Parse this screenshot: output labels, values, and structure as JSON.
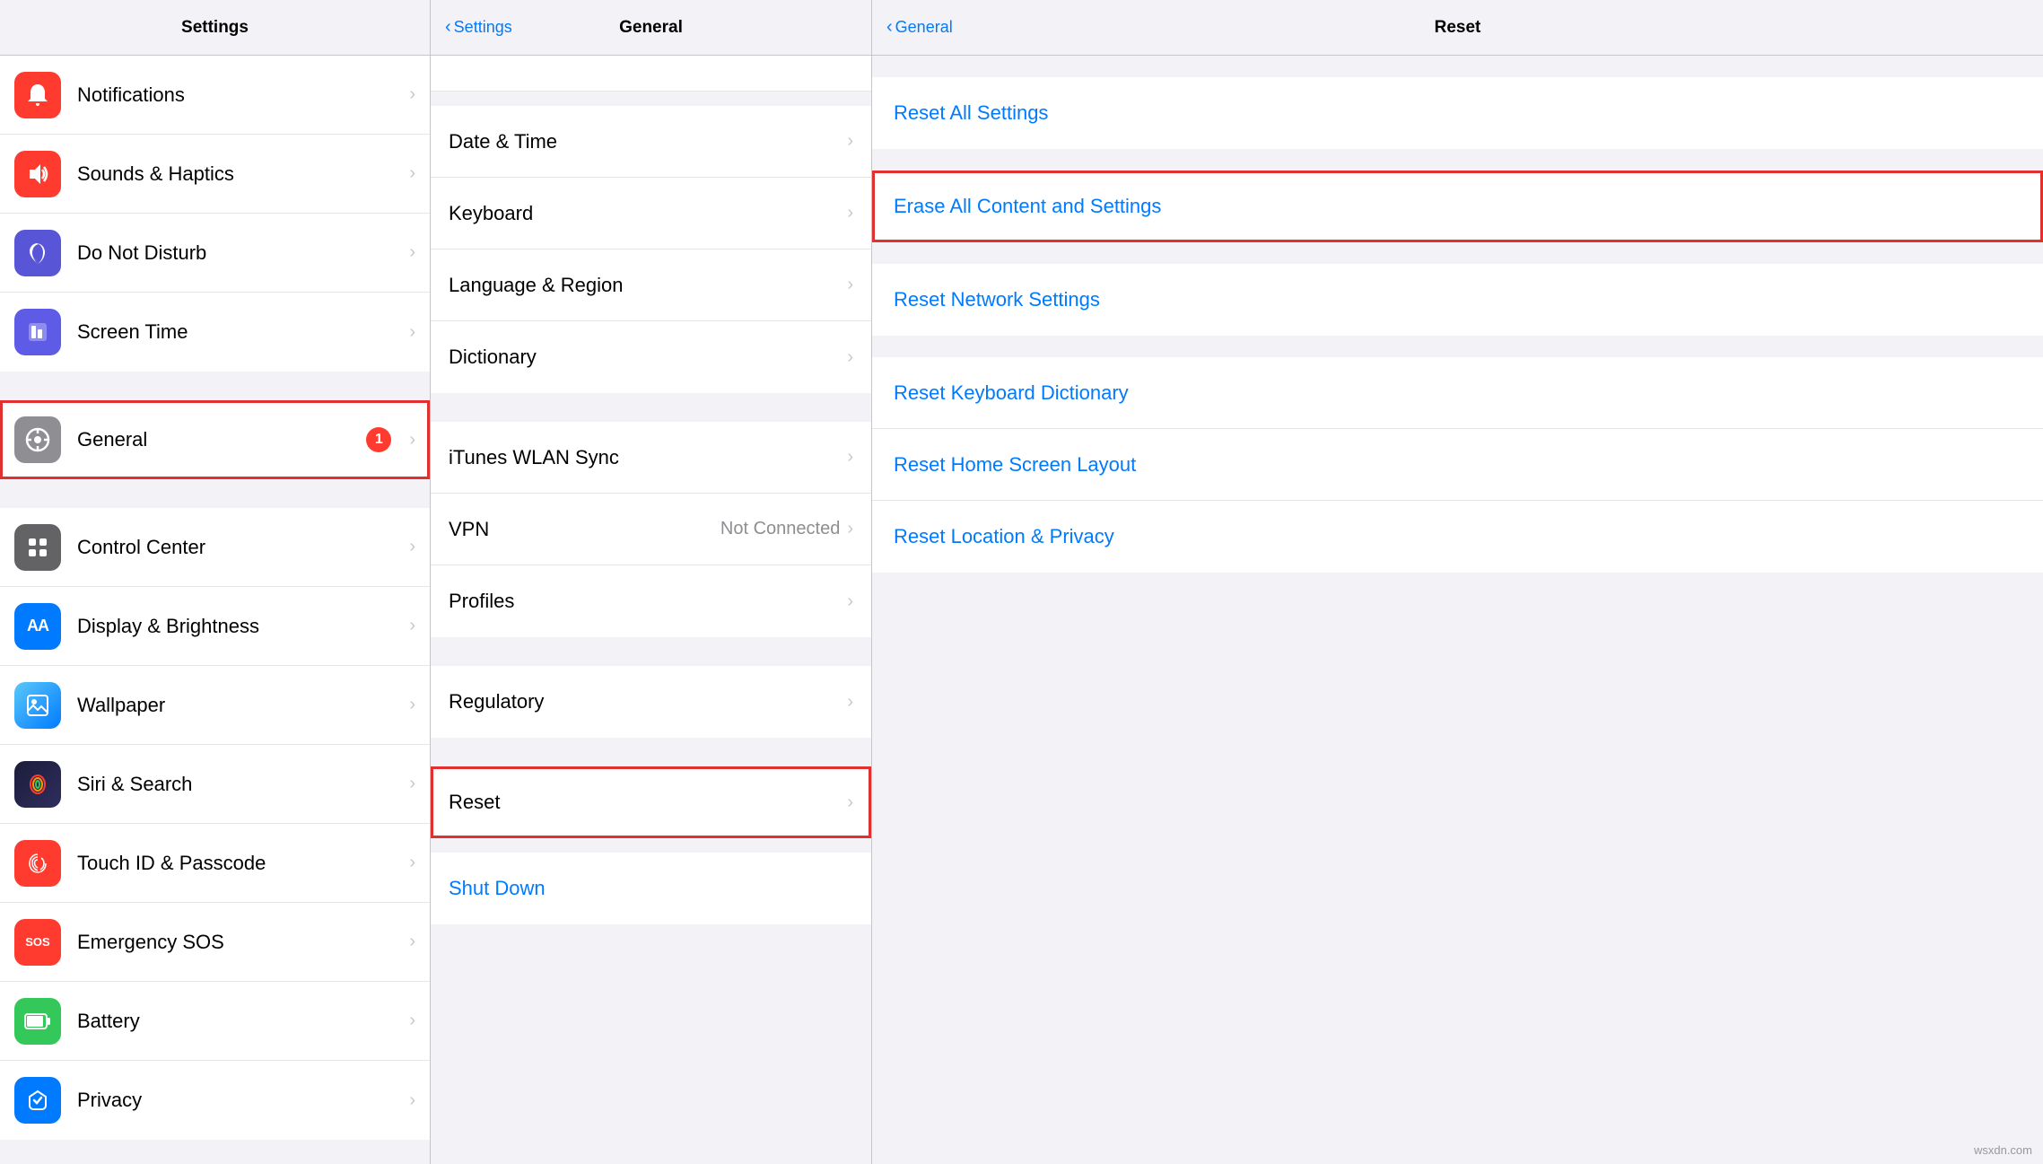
{
  "left_column": {
    "title": "Settings",
    "items": [
      {
        "id": "notifications",
        "label": "Notifications",
        "icon_bg": "icon-red",
        "icon_symbol": "🔔",
        "badge": null,
        "highlighted": false
      },
      {
        "id": "sounds",
        "label": "Sounds & Haptics",
        "icon_bg": "icon-red",
        "icon_symbol": "🔊",
        "badge": null,
        "highlighted": false
      },
      {
        "id": "do-not-disturb",
        "label": "Do Not Disturb",
        "icon_bg": "icon-purple-dark",
        "icon_symbol": "🌙",
        "badge": null,
        "highlighted": false
      },
      {
        "id": "screen-time",
        "label": "Screen Time",
        "icon_bg": "icon-purple",
        "icon_symbol": "⌛",
        "badge": null,
        "highlighted": false
      },
      {
        "id": "general",
        "label": "General",
        "icon_bg": "icon-gray",
        "icon_symbol": "⚙️",
        "badge": "1",
        "highlighted": true
      },
      {
        "id": "control-center",
        "label": "Control Center",
        "icon_bg": "icon-control",
        "icon_symbol": "⊞",
        "badge": null,
        "highlighted": false
      },
      {
        "id": "display-brightness",
        "label": "Display & Brightness",
        "icon_bg": "icon-aa",
        "icon_symbol": "AA",
        "badge": null,
        "highlighted": false
      },
      {
        "id": "wallpaper",
        "label": "Wallpaper",
        "icon_bg": "icon-wallpaper",
        "icon_symbol": "🖼",
        "badge": null,
        "highlighted": false
      },
      {
        "id": "siri-search",
        "label": "Siri & Search",
        "icon_bg": "icon-siri",
        "icon_symbol": "◉",
        "badge": null,
        "highlighted": false
      },
      {
        "id": "touch-id",
        "label": "Touch ID & Passcode",
        "icon_bg": "icon-fingerprint",
        "icon_symbol": "👆",
        "badge": null,
        "highlighted": false
      },
      {
        "id": "emergency-sos",
        "label": "Emergency SOS",
        "icon_bg": "icon-sos",
        "icon_symbol": "SOS",
        "badge": null,
        "highlighted": false
      },
      {
        "id": "battery",
        "label": "Battery",
        "icon_bg": "icon-green",
        "icon_symbol": "🔋",
        "badge": null,
        "highlighted": false
      },
      {
        "id": "privacy",
        "label": "Privacy",
        "icon_bg": "icon-blue-privacy",
        "icon_symbol": "✋",
        "badge": null,
        "highlighted": false
      }
    ]
  },
  "middle_column": {
    "back_label": "Settings",
    "title": "General",
    "items_top": [
      {
        "id": "date-time",
        "label": "Date & Time",
        "value": "",
        "highlighted": false
      },
      {
        "id": "keyboard",
        "label": "Keyboard",
        "value": "",
        "highlighted": false
      },
      {
        "id": "language-region",
        "label": "Language & Region",
        "value": "",
        "highlighted": false
      },
      {
        "id": "dictionary",
        "label": "Dictionary",
        "value": "",
        "highlighted": false
      }
    ],
    "items_mid": [
      {
        "id": "itunes-wlan",
        "label": "iTunes WLAN Sync",
        "value": "",
        "highlighted": false
      },
      {
        "id": "vpn",
        "label": "VPN",
        "value": "Not Connected",
        "highlighted": false
      },
      {
        "id": "profiles",
        "label": "Profiles",
        "value": "",
        "highlighted": false
      }
    ],
    "items_bottom": [
      {
        "id": "regulatory",
        "label": "Regulatory",
        "value": "",
        "highlighted": false
      }
    ],
    "items_reset": [
      {
        "id": "reset",
        "label": "Reset",
        "value": "",
        "highlighted": true
      },
      {
        "id": "shut-down",
        "label": "Shut Down",
        "value": "",
        "is_blue": true,
        "highlighted": false
      }
    ]
  },
  "right_column": {
    "back_label": "General",
    "title": "Reset",
    "groups": [
      {
        "items": [
          {
            "id": "reset-all-settings",
            "label": "Reset All Settings",
            "highlighted": false
          }
        ]
      },
      {
        "items": [
          {
            "id": "erase-all",
            "label": "Erase All Content and Settings",
            "highlighted": true
          }
        ]
      },
      {
        "items": [
          {
            "id": "reset-network",
            "label": "Reset Network Settings",
            "highlighted": false
          }
        ]
      },
      {
        "items": [
          {
            "id": "reset-keyboard",
            "label": "Reset Keyboard Dictionary",
            "highlighted": false
          },
          {
            "id": "reset-home",
            "label": "Reset Home Screen Layout",
            "highlighted": false
          },
          {
            "id": "reset-location",
            "label": "Reset Location & Privacy",
            "highlighted": false
          }
        ]
      }
    ]
  },
  "watermark": "wsxdn.com"
}
